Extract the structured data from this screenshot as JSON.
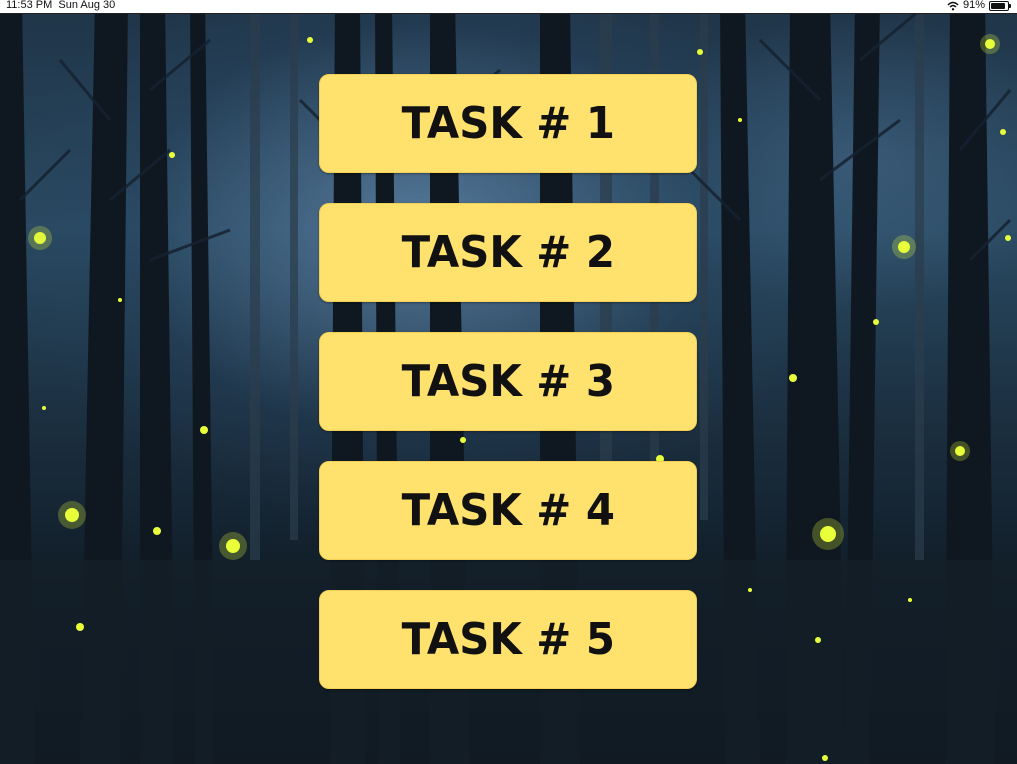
{
  "status_bar": {
    "time": "11:53 PM",
    "date": "Sun Aug 30",
    "battery_percent": "91%",
    "wifi_icon": "wifi-icon",
    "battery_icon": "battery-icon"
  },
  "background": {
    "description_icon": "forest-fireflies-background",
    "firefly_color": "#e8ff3a",
    "sky_color": "#2a4a62"
  },
  "tasks": {
    "button_color": "#ffe16e",
    "items": [
      {
        "label": "TASK # 1"
      },
      {
        "label": "TASK # 2"
      },
      {
        "label": "TASK # 3"
      },
      {
        "label": "TASK # 4"
      },
      {
        "label": "TASK # 5"
      }
    ]
  }
}
